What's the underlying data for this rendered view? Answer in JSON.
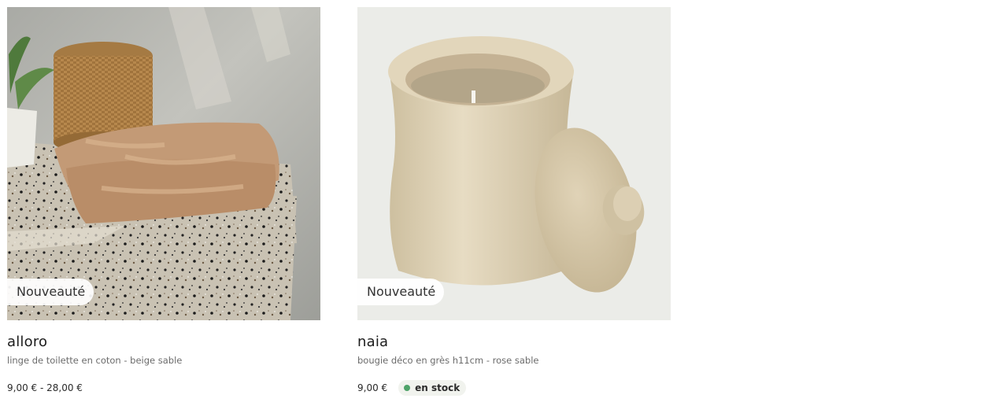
{
  "products": [
    {
      "badge": "Nouveauté",
      "name": "alloro",
      "description": "linge de toilette en coton - beige sable",
      "price": "9,00 € - 28,00 €",
      "image_subject": "towel-and-basket-photo"
    },
    {
      "badge": "Nouveauté",
      "name": "naia",
      "description": "bougie déco en grès h11cm - rose sable",
      "price": "9,00 €",
      "stock_label": "en stock",
      "stock_color": "#4fa36a",
      "image_subject": "ceramic-candle-photo"
    }
  ]
}
